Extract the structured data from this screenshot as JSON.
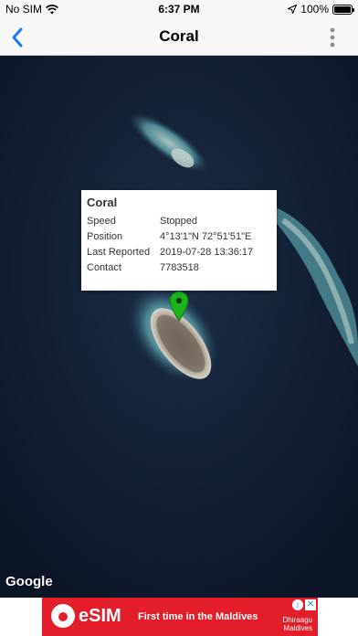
{
  "status_bar": {
    "carrier": "No SIM",
    "time": "6:37 PM",
    "battery": "100%",
    "icons": [
      "wifi-icon",
      "location-arrow-icon",
      "battery-icon"
    ]
  },
  "nav": {
    "title": "Coral",
    "back_icon": "chevron-left-icon",
    "menu_icon": "vertical-ellipsis-icon",
    "accent_color": "#1a7cf2"
  },
  "info_window": {
    "title": "Coral",
    "rows": [
      {
        "key": "Speed",
        "value": "Stopped"
      },
      {
        "key": "Position",
        "value": "4°13'1\"N 72°51'51\"E"
      },
      {
        "key": "Last Reported",
        "value": "2019-07-28 13:36:17"
      },
      {
        "key": "Contact",
        "value": "7783518"
      }
    ]
  },
  "map": {
    "attribution": "Google",
    "marker_color": "#1db31d"
  },
  "ad": {
    "brand": "eSIM",
    "headline": "First time in the Maldives",
    "sponsor_line1": "Dhiraagu",
    "sponsor_line2": "Maldives",
    "background_color": "#e31e2a"
  }
}
